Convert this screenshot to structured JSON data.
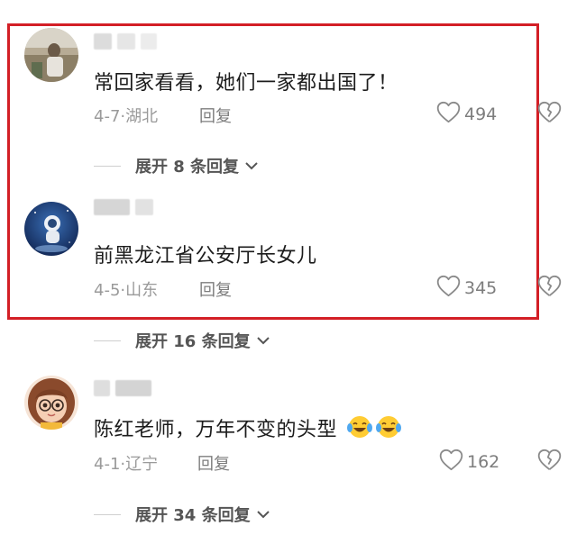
{
  "comments": [
    {
      "text": "常回家看看，她们一家都出国了！",
      "date": "4-7",
      "separator": "·",
      "location": "湖北",
      "reply_label": "回复",
      "likes": "494",
      "expand_label": "展开 8 条回复"
    },
    {
      "text": "前黑龙江省公安厅长女儿",
      "date": "4-5",
      "separator": "·",
      "location": "山东",
      "reply_label": "回复",
      "likes": "345",
      "expand_label": "展开 16 条回复"
    },
    {
      "text": "陈红老师，万年不变的头型",
      "emoji_count": 2,
      "date": "4-1",
      "separator": "·",
      "location": "辽宁",
      "reply_label": "回复",
      "likes": "162",
      "expand_label": "展开 34 条回复"
    }
  ],
  "colors": {
    "highlight_border": "#d31f26",
    "meta_text": "#9a9a9a",
    "icon_stroke": "#8a8a8a"
  },
  "icons": {
    "like": "heart-outline-icon",
    "dislike": "broken-heart-icon",
    "expand": "chevron-down-icon",
    "emoji": "laughing-tears-emoji"
  }
}
